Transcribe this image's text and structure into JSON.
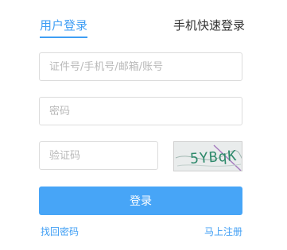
{
  "tabs": {
    "user_login": "用户登录",
    "phone_login": "手机快速登录"
  },
  "form": {
    "account_placeholder": "证件号/手机号/邮箱/账号",
    "password_placeholder": "密码",
    "captcha_placeholder": "验证码",
    "captcha_image_text": "5YBqK",
    "login_label": "登录"
  },
  "links": {
    "forgot_password": "找回密码",
    "register": "马上注册"
  },
  "colors": {
    "accent": "#3f9ef4",
    "button": "#47a5f7",
    "border": "#dcdcdc"
  }
}
